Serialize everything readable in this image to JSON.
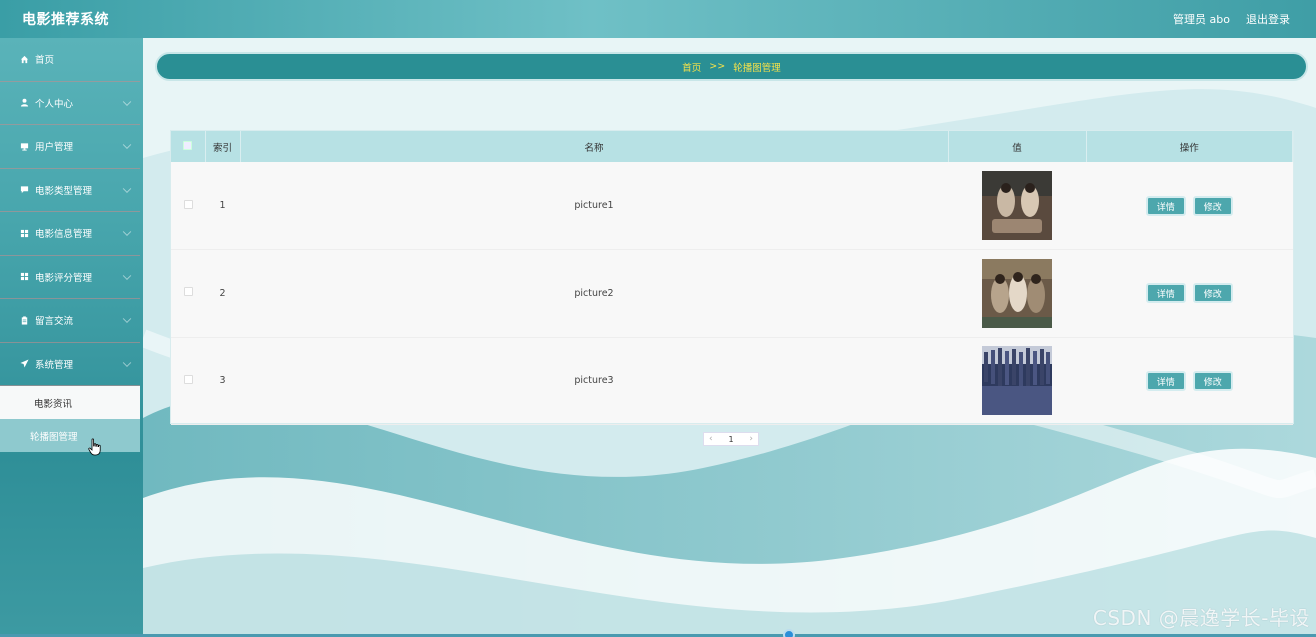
{
  "header": {
    "title": "电影推荐系统",
    "user": "管理员 abo",
    "logout": "退出登录"
  },
  "sidebar": {
    "items": [
      {
        "label": "首页",
        "icon": "home-icon"
      },
      {
        "label": "个人中心",
        "icon": "user-icon"
      },
      {
        "label": "用户管理",
        "icon": "monitor-icon"
      },
      {
        "label": "电影类型管理",
        "icon": "comment-icon"
      },
      {
        "label": "电影信息管理",
        "icon": "grid-icon"
      },
      {
        "label": "电影评分管理",
        "icon": "grid-icon"
      },
      {
        "label": "留言交流",
        "icon": "clipboard-icon"
      },
      {
        "label": "系统管理",
        "icon": "send-icon"
      }
    ],
    "submenu": [
      {
        "label": "电影资讯"
      },
      {
        "label": "轮播图管理"
      }
    ]
  },
  "breadcrumb": {
    "home": "首页",
    "separator": ">>",
    "current": "轮播图管理"
  },
  "table": {
    "headers": [
      "索引",
      "名称",
      "值",
      "操作"
    ],
    "rows": [
      {
        "index": "1",
        "name": "picture1"
      },
      {
        "index": "2",
        "name": "picture2"
      },
      {
        "index": "3",
        "name": "picture3"
      }
    ],
    "detail_label": "详情",
    "edit_label": "修改"
  },
  "pagination": {
    "current": "1"
  },
  "watermark": "CSDN @晨逸学长-毕设"
}
